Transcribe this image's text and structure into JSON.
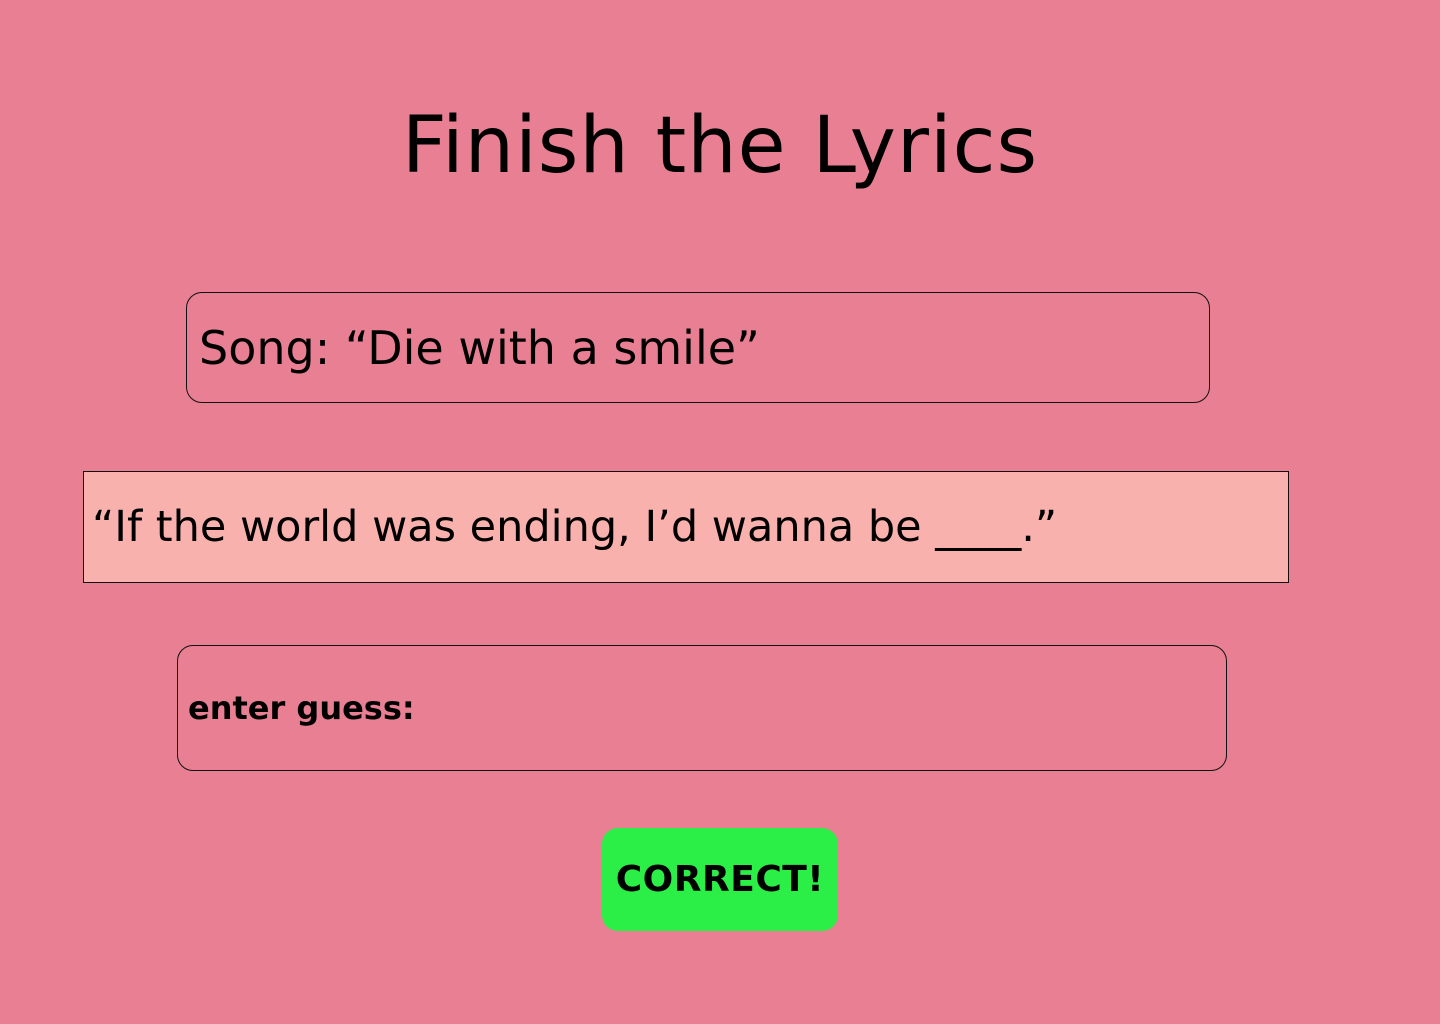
{
  "page": {
    "title": "Finish the Lyrics",
    "background_color": "#e87f92"
  },
  "song": {
    "text": "Song: “Die with a smile”"
  },
  "lyric": {
    "text": "“If the world was ending, I’d wanna be ____.”",
    "background_color": "#f9b1ae"
  },
  "guess": {
    "label": "enter guess:",
    "value": ""
  },
  "result_button": {
    "label": "CORRECT!",
    "color": "#2bef47"
  }
}
